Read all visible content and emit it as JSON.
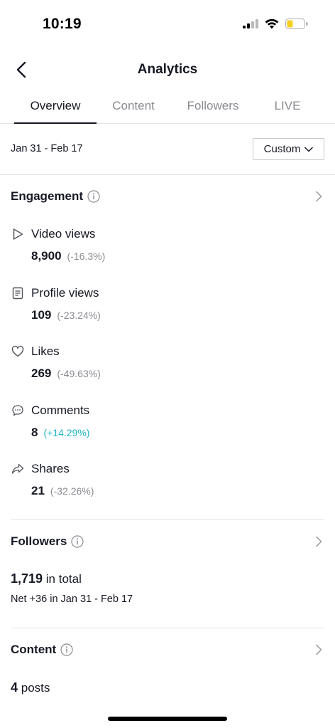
{
  "status_bar": {
    "time": "10:19",
    "icons": [
      "signal-icon",
      "wifi-icon",
      "battery-icon"
    ],
    "battery_color": "#f5d020"
  },
  "header": {
    "title": "Analytics",
    "back_icon": "chevron-left-icon"
  },
  "tabs": [
    {
      "label": "Overview",
      "active": true
    },
    {
      "label": "Content",
      "active": false
    },
    {
      "label": "Followers",
      "active": false
    },
    {
      "label": "LIVE",
      "active": false
    }
  ],
  "date_filter": {
    "range": "Jan 31 - Feb 17",
    "button_label": "Custom"
  },
  "engagement": {
    "title": "Engagement",
    "metrics": [
      {
        "icon": "play-icon",
        "label": "Video views",
        "value": "8,900",
        "change": "(-16.3%)"
      },
      {
        "icon": "profile-doc-icon",
        "label": "Profile views",
        "value": "109",
        "change": "(-23.24%)"
      },
      {
        "icon": "heart-icon",
        "label": "Likes",
        "value": "269",
        "change": "(-49.63%)"
      },
      {
        "icon": "comment-icon",
        "label": "Comments",
        "value": "8",
        "change": "(+14.29%)"
      },
      {
        "icon": "share-icon",
        "label": "Shares",
        "value": "21",
        "change": "(-32.26%)"
      }
    ]
  },
  "followers": {
    "title": "Followers",
    "total": "1,719",
    "total_suffix": "in total",
    "net": "Net +36 in Jan 31 - Feb 17"
  },
  "content": {
    "title": "Content",
    "posts": "4",
    "posts_suffix": "posts"
  },
  "colors": {
    "positive_change": "#20b3c7",
    "neutral_change": "#8a8b91",
    "text": "#161823"
  }
}
